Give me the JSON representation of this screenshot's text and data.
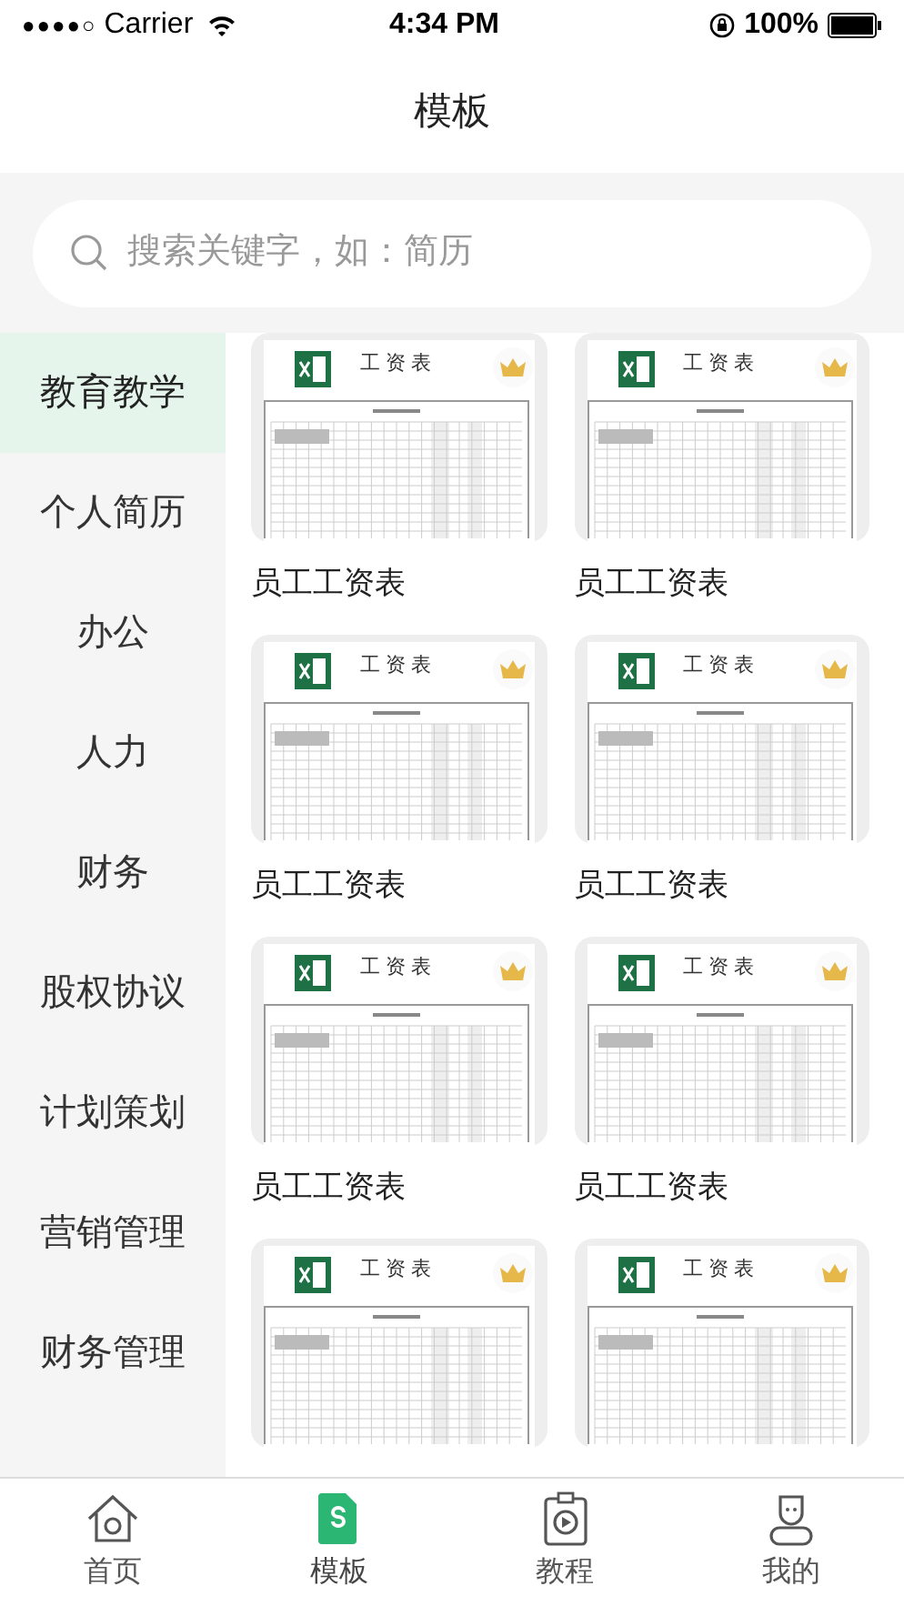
{
  "status_bar": {
    "signal": "●●●●○",
    "carrier": "Carrier",
    "time": "4:34 PM",
    "battery": "100%"
  },
  "nav": {
    "title": "模板"
  },
  "search": {
    "placeholder": "搜索关键字，如：简历"
  },
  "sidebar": {
    "items": [
      {
        "label": "教育教学",
        "selected": true
      },
      {
        "label": "个人简历",
        "selected": false
      },
      {
        "label": "办公",
        "selected": false
      },
      {
        "label": "人力",
        "selected": false
      },
      {
        "label": "财务",
        "selected": false
      },
      {
        "label": "股权协议",
        "selected": false
      },
      {
        "label": "计划策划",
        "selected": false
      },
      {
        "label": "营销管理",
        "selected": false
      },
      {
        "label": "财务管理",
        "selected": false
      }
    ]
  },
  "templates": [
    {
      "thumb_title": "工 资 表",
      "name": "员工工资表",
      "premium": true
    },
    {
      "thumb_title": "工 资 表",
      "name": "员工工资表",
      "premium": true
    },
    {
      "thumb_title": "工 资 表",
      "name": "员工工资表",
      "premium": true
    },
    {
      "thumb_title": "工 资 表",
      "name": "员工工资表",
      "premium": true
    },
    {
      "thumb_title": "工 资 表",
      "name": "员工工资表",
      "premium": true
    },
    {
      "thumb_title": "工 资 表",
      "name": "员工工资表",
      "premium": true
    },
    {
      "thumb_title": "工 资 表",
      "premium": true
    },
    {
      "thumb_title": "工 资 表",
      "premium": true
    }
  ],
  "tab_bar": [
    {
      "kind": "home",
      "label": "首页",
      "selected": false
    },
    {
      "kind": "template",
      "label": "模板",
      "selected": true
    },
    {
      "kind": "tutorial",
      "label": "教程",
      "selected": false
    },
    {
      "kind": "me",
      "label": "我的",
      "selected": false
    }
  ]
}
